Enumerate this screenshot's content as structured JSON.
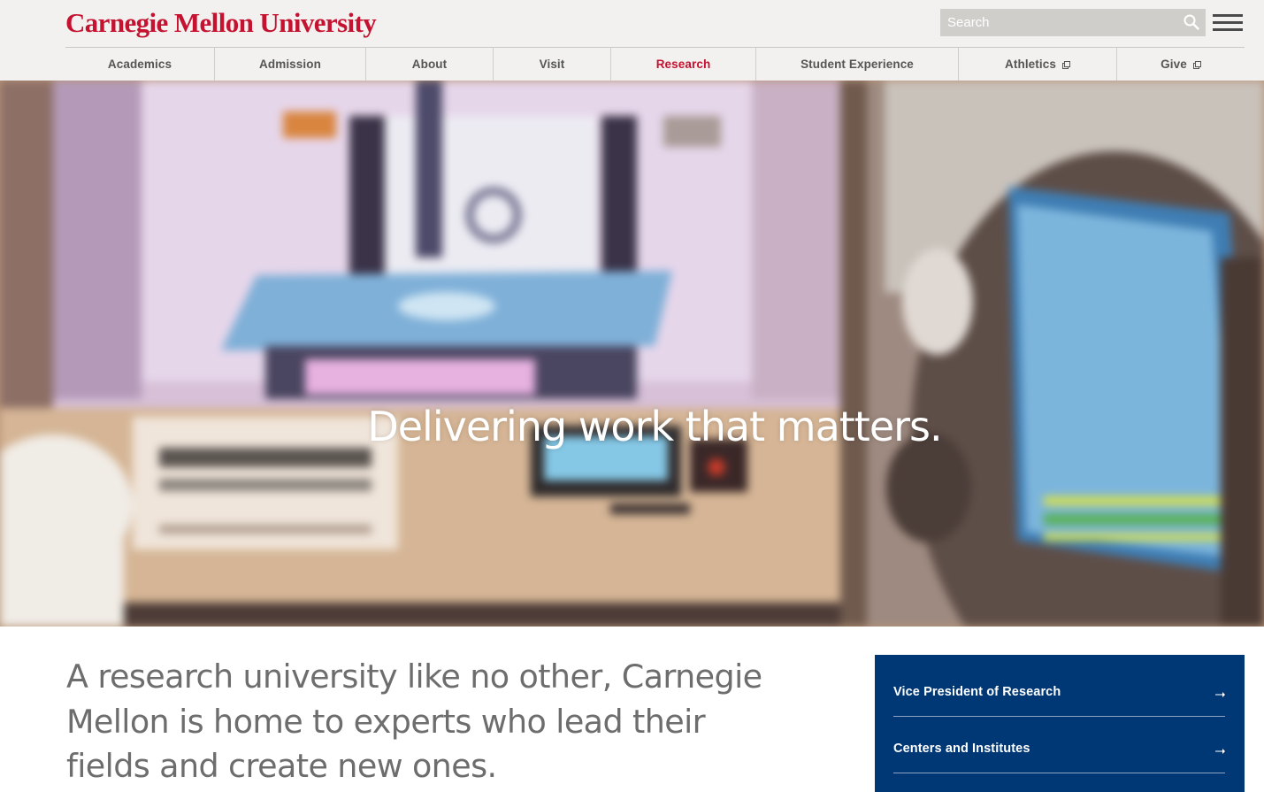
{
  "header": {
    "logo_text": "Carnegie Mellon University",
    "search": {
      "placeholder": "Search",
      "value": ""
    },
    "search_icon": "search-icon",
    "menu_icon": "hamburger-menu-icon"
  },
  "nav": {
    "items": [
      {
        "label": "Academics",
        "active": false,
        "external": false
      },
      {
        "label": "Admission",
        "active": false,
        "external": false
      },
      {
        "label": "About",
        "active": false,
        "external": false
      },
      {
        "label": "Visit",
        "active": false,
        "external": false
      },
      {
        "label": "Research",
        "active": true,
        "external": false
      },
      {
        "label": "Student Experience",
        "active": false,
        "external": false
      },
      {
        "label": "Athletics",
        "active": false,
        "external": true
      },
      {
        "label": "Give",
        "active": false,
        "external": true
      }
    ]
  },
  "hero": {
    "headline": "Delivering work that matters."
  },
  "intro": {
    "text": "A research university like no other, Carnegie Mellon is home to experts who lead their fields and create new ones."
  },
  "sidebar": {
    "links": [
      {
        "label": "Vice President of Research",
        "icon": "arrow-right-icon"
      },
      {
        "label": "Centers and Institutes",
        "icon": "arrow-right-icon"
      }
    ]
  },
  "colors": {
    "brand_red": "#c41230",
    "sidebar_blue": "#003876",
    "header_bg": "#f2f1ef",
    "nav_text": "#555555",
    "intro_text": "#6d6d6d"
  }
}
